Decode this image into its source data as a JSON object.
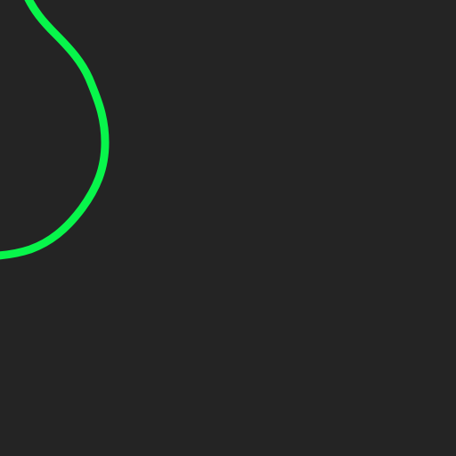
{
  "canvas": {
    "background_color": "#242424"
  },
  "stroke": {
    "color": "#08F54B"
  }
}
